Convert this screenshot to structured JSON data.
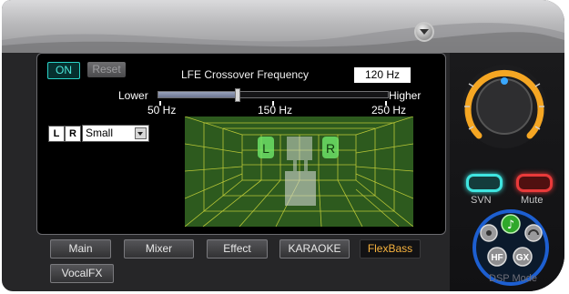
{
  "header": {
    "on_label": "ON",
    "reset_label": "Reset",
    "title": "LFE Crossover Frequency",
    "value": "120 Hz"
  },
  "slider": {
    "lower_label": "Lower",
    "higher_label": "Higher",
    "ticks": [
      "50 Hz",
      "150 Hz",
      "250 Hz"
    ],
    "level_fraction": 0.35
  },
  "speaker": {
    "left_label": "L",
    "right_label": "R",
    "size_selected": "Small"
  },
  "room": {
    "left_marker": "L",
    "right_marker": "R"
  },
  "tabs": [
    {
      "label": "Main"
    },
    {
      "label": "Mixer"
    },
    {
      "label": "Effect"
    },
    {
      "label": "KARAOKE"
    },
    {
      "label": "FlexBass",
      "active": true
    },
    {
      "label": "VocalFX"
    }
  ],
  "right": {
    "svn_label": "SVN",
    "mute_label": "Mute",
    "dsp_label": "DSP Mode",
    "dsp_buttons": [
      "HF",
      "GX"
    ]
  },
  "colors": {
    "accent_teal": "#3fe5e0",
    "mute_red": "#e93a3a",
    "active_tab": "#f7b33e",
    "knob_ring": "#f5a623",
    "room_grid": "#c8d23a"
  },
  "icons": [
    "dropdown-arrow-icon",
    "volume-knob-icon",
    "music-note-icon",
    "headphones-icon",
    "speaker-icon",
    "down-arrow-icon"
  ]
}
